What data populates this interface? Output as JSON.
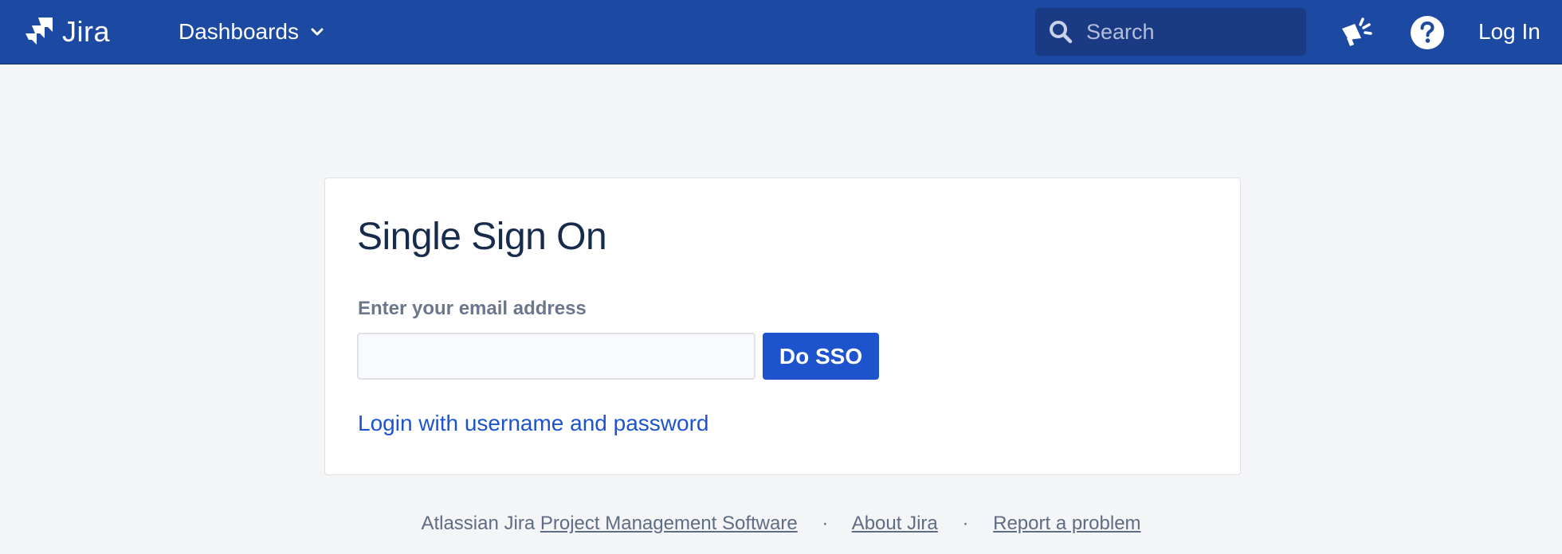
{
  "header": {
    "app_name": "Jira",
    "nav": {
      "dashboards_label": "Dashboards"
    },
    "search": {
      "placeholder": "Search",
      "value": ""
    },
    "login_label": "Log In",
    "icons": {
      "logo": "jira-logo-icon",
      "dropdown": "chevron-down-icon",
      "search": "search-icon",
      "announce": "megaphone-icon",
      "help": "help-icon"
    }
  },
  "sso_card": {
    "title": "Single Sign On",
    "email_label": "Enter your email address",
    "email_value": "",
    "submit_label": "Do SSO",
    "alt_login_label": "Login with username and password"
  },
  "footer": {
    "prefix": "Atlassian Jira",
    "links": {
      "pm_software": "Project Management Software",
      "about": "About Jira",
      "report": "Report a problem"
    },
    "separator": "·"
  },
  "colors": {
    "header_bg": "#1c4aa2",
    "page_bg": "#f4f5f7",
    "primary": "#1d54cd",
    "title_text": "#172b4d",
    "muted_text": "#6b778c"
  }
}
